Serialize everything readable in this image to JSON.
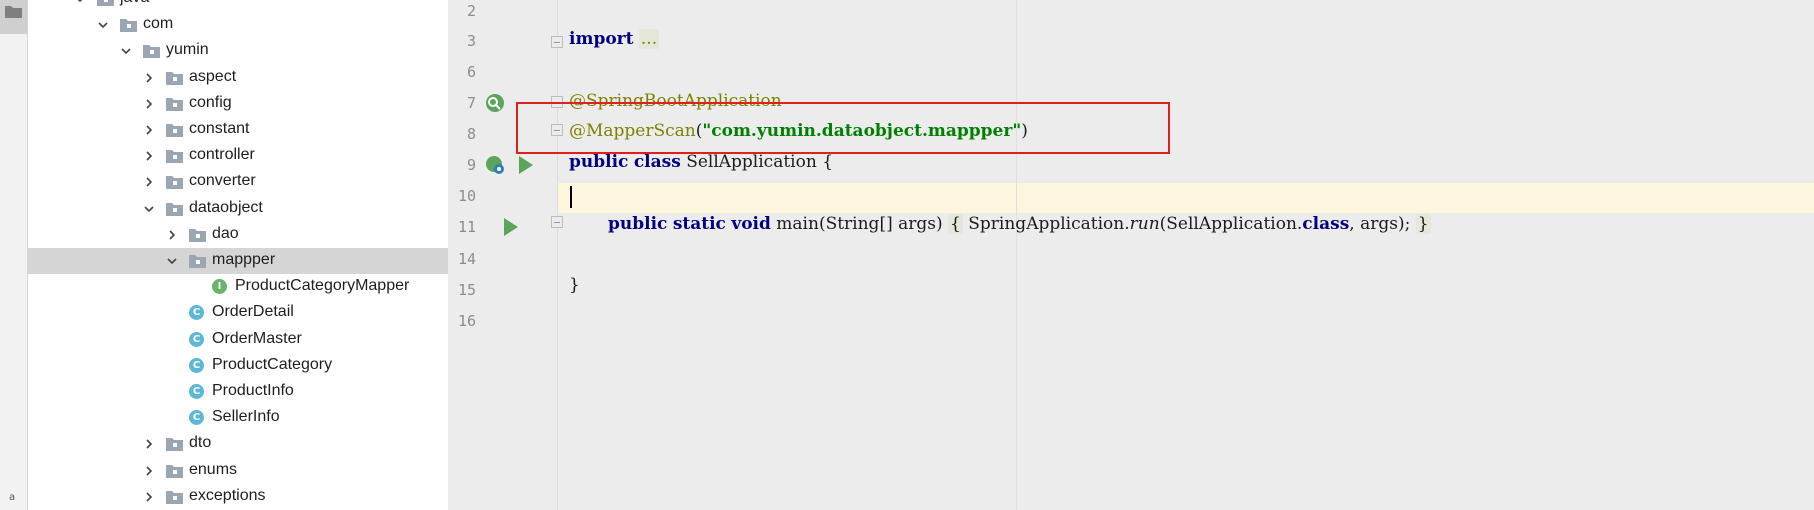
{
  "sidebar_strip": {
    "bottom_char": "a"
  },
  "tree": {
    "items": [
      {
        "label": "java",
        "kind": "folder",
        "expanded": true
      },
      {
        "label": "com",
        "kind": "folder",
        "expanded": true
      },
      {
        "label": "yumin",
        "kind": "folder",
        "expanded": true
      },
      {
        "label": "aspect",
        "kind": "folder",
        "expanded": false
      },
      {
        "label": "config",
        "kind": "folder",
        "expanded": false
      },
      {
        "label": "constant",
        "kind": "folder",
        "expanded": false
      },
      {
        "label": "controller",
        "kind": "folder",
        "expanded": false
      },
      {
        "label": "converter",
        "kind": "folder",
        "expanded": false
      },
      {
        "label": "dataobject",
        "kind": "folder",
        "expanded": true
      },
      {
        "label": "dao",
        "kind": "folder",
        "expanded": false
      },
      {
        "label": "mappper",
        "kind": "folder",
        "expanded": true,
        "selected": true
      },
      {
        "label": "ProductCategoryMapper",
        "kind": "interface",
        "badge": "I"
      },
      {
        "label": "OrderDetail",
        "kind": "class",
        "badge": "C"
      },
      {
        "label": "OrderMaster",
        "kind": "class",
        "badge": "C"
      },
      {
        "label": "ProductCategory",
        "kind": "class",
        "badge": "C"
      },
      {
        "label": "ProductInfo",
        "kind": "class",
        "badge": "C"
      },
      {
        "label": "SellerInfo",
        "kind": "class",
        "badge": "C"
      },
      {
        "label": "dto",
        "kind": "folder",
        "expanded": false
      },
      {
        "label": "enums",
        "kind": "folder",
        "expanded": false
      },
      {
        "label": "exceptions",
        "kind": "folder",
        "expanded": false
      }
    ]
  },
  "editor": {
    "line_numbers": [
      "2",
      "3",
      "6",
      "7",
      "8",
      "9",
      "10",
      "11",
      "14",
      "15",
      "16"
    ],
    "code": {
      "import_kw": "import",
      "import_fold": "...",
      "spring_boot_anno": "@SpringBootApplication",
      "mapper_scan_anno": "@MapperScan",
      "mapper_scan_open": "(",
      "mapper_scan_str": "\"com.yumin.dataobject.mappper\"",
      "mapper_scan_close": ")",
      "class_public": "public",
      "class_kw": "class",
      "class_name": "SellApplication {",
      "main_public": "public",
      "main_static": "static",
      "main_void": "void",
      "main_sig": "main(String[] args)",
      "main_body_open": "{",
      "main_body_call": "SpringApplication.",
      "main_body_run": "run",
      "main_body_args_a": "(SellApplication.",
      "main_body_class_kw": "class",
      "main_body_args_b": ", args);",
      "main_body_close": "}",
      "class_close": "}"
    },
    "colors": {
      "keyword": "#000080",
      "annotation": "#808000",
      "string": "#008000",
      "highlight_box": "#e0201c",
      "current_line": "#fbf6dc"
    }
  }
}
